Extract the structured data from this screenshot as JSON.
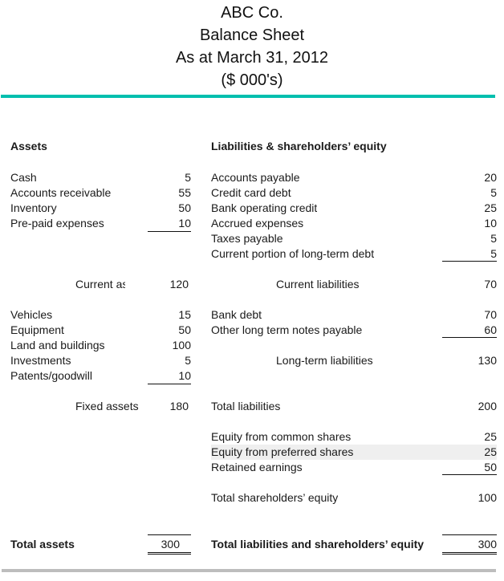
{
  "header": {
    "company": "ABC Co.",
    "title": "Balance Sheet",
    "date": "As at March 31, 2012",
    "units": "($ 000's)"
  },
  "assets": {
    "heading": "Assets",
    "current": [
      {
        "label": "Cash",
        "value": "5"
      },
      {
        "label": "Accounts receivable",
        "value": "55"
      },
      {
        "label": "Inventory",
        "value": "50"
      },
      {
        "label": "Pre-paid expenses",
        "value": "10"
      }
    ],
    "current_total": {
      "label": "Current assets",
      "value": "120"
    },
    "fixed": [
      {
        "label": "Vehicles",
        "value": "15"
      },
      {
        "label": "Equipment",
        "value": "50"
      },
      {
        "label": "Land and buildings",
        "value": "100"
      },
      {
        "label": "Investments",
        "value": "5"
      },
      {
        "label": "Patents/goodwill",
        "value": "10"
      }
    ],
    "fixed_total": {
      "label": "Fixed assets",
      "value": "180"
    },
    "grand_total": {
      "label": "Total assets",
      "value": "300"
    }
  },
  "liabilities": {
    "heading": "Liabilities & shareholders’ equity",
    "current": [
      {
        "label": "Accounts payable",
        "value": "20"
      },
      {
        "label": "Credit card debt",
        "value": "5"
      },
      {
        "label": "Bank operating credit",
        "value": "25"
      },
      {
        "label": "Accrued expenses",
        "value": "10"
      },
      {
        "label": "Taxes payable",
        "value": "5"
      },
      {
        "label": "Current portion of long-term debt",
        "value": "5"
      }
    ],
    "current_total": {
      "label": "Current liabilities",
      "value": "70"
    },
    "long_term": [
      {
        "label": "Bank debt",
        "value": "70"
      },
      {
        "label": "Other long term notes payable",
        "value": "60"
      }
    ],
    "long_term_total": {
      "label": "Long-term liabilities",
      "value": "130"
    },
    "total_liabilities": {
      "label": "Total liabilities",
      "value": "200"
    },
    "equity": [
      {
        "label": "Equity from common shares",
        "value": "25"
      },
      {
        "label": "Equity from preferred shares",
        "value": "25"
      },
      {
        "label": "Retained earnings",
        "value": "50"
      }
    ],
    "equity_total": {
      "label": "Total shareholders’ equity",
      "value": "100"
    },
    "grand_total": {
      "label": "Total liabilities and shareholders’ equity",
      "value": "300"
    }
  },
  "colors": {
    "accent_rule": "#00bfae",
    "bottom_rule": "#bdbdbd",
    "highlight_row": "#efefef"
  }
}
